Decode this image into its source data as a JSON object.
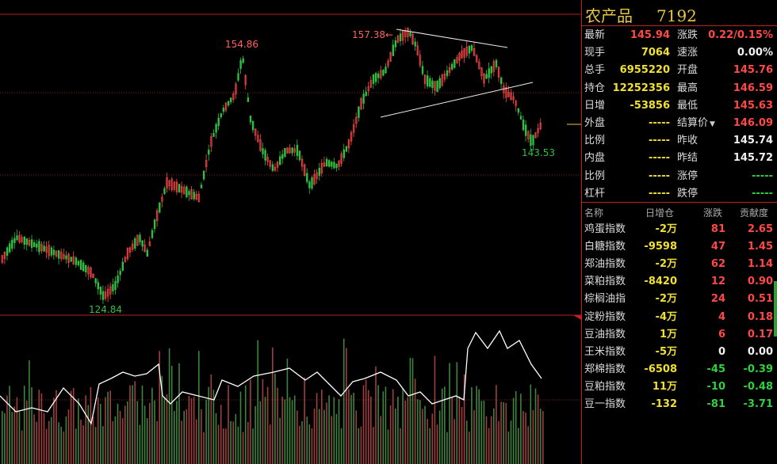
{
  "header": {
    "name": "农产品",
    "code": "7192"
  },
  "price_labels": {
    "high": "157.38",
    "high_arrow": "←",
    "mid_high": "154.86",
    "low": "124.84",
    "recent_low": "143.53"
  },
  "quote_left": [
    {
      "label": "最新",
      "value": "145.94",
      "color": "red"
    },
    {
      "label": "现手",
      "value": "7064",
      "color": "yel"
    },
    {
      "label": "总手",
      "value": "6955220",
      "color": "yel"
    },
    {
      "label": "持仓",
      "value": "12252356",
      "color": "yel"
    },
    {
      "label": "日增",
      "value": "-53856",
      "color": "yel"
    },
    {
      "label": "外盘",
      "value": "-----",
      "color": "yel"
    },
    {
      "label": "比例",
      "value": "-----",
      "color": "yel"
    },
    {
      "label": "内盘",
      "value": "-----",
      "color": "yel"
    },
    {
      "label": "比例",
      "value": "-----",
      "color": "yel"
    },
    {
      "label": "杠杆",
      "value": "-----",
      "color": "yel"
    }
  ],
  "quote_right": [
    {
      "label": "涨跌",
      "value": "0.22/0.15%",
      "color": "red"
    },
    {
      "label": "速涨",
      "value": "0.00%",
      "color": "wht"
    },
    {
      "label": "开盘",
      "value": "145.76",
      "color": "red"
    },
    {
      "label": "最高",
      "value": "146.59",
      "color": "red"
    },
    {
      "label": "最低",
      "value": "145.63",
      "color": "red"
    },
    {
      "label": "结算价",
      "value": "146.09",
      "color": "red",
      "dropdown": "▼"
    },
    {
      "label": "昨收",
      "value": "145.74",
      "color": "wht"
    },
    {
      "label": "昨结",
      "value": "145.72",
      "color": "wht"
    },
    {
      "label": "涨停",
      "value": "-----",
      "color": "grn"
    },
    {
      "label": "跌停",
      "value": "-----",
      "color": "grn"
    }
  ],
  "constituents": {
    "headers": [
      "名称",
      "日增仓",
      "涨跌",
      "贡献度"
    ],
    "rows": [
      {
        "name": "鸡蛋指数",
        "oi": "-2万",
        "chg": "81",
        "contrib": "2.65",
        "c": "red"
      },
      {
        "name": "白糖指数",
        "oi": "-9598",
        "chg": "47",
        "contrib": "1.45",
        "c": "red"
      },
      {
        "name": "郑油指数",
        "oi": "-2万",
        "chg": "62",
        "contrib": "1.14",
        "c": "red"
      },
      {
        "name": "菜粕指数",
        "oi": "-8420",
        "chg": "12",
        "contrib": "0.90",
        "c": "red"
      },
      {
        "name": "棕榈油指",
        "oi": "-2万",
        "chg": "24",
        "contrib": "0.51",
        "c": "red"
      },
      {
        "name": "淀粉指数",
        "oi": "-4万",
        "chg": "4",
        "contrib": "0.18",
        "c": "red"
      },
      {
        "name": "豆油指数",
        "oi": "1万",
        "chg": "6",
        "contrib": "0.17",
        "c": "red"
      },
      {
        "name": "王米指数",
        "oi": "-5万",
        "chg": "0",
        "contrib": "0.00",
        "c": "wht"
      },
      {
        "name": "郑棉指数",
        "oi": "-6508",
        "chg": "-45",
        "contrib": "-0.39",
        "c": "grn"
      },
      {
        "name": "豆粕指数",
        "oi": "11万",
        "chg": "-10",
        "contrib": "-0.48",
        "c": "grn"
      },
      {
        "name": "豆一指数",
        "oi": "-132",
        "chg": "-81",
        "contrib": "-3.71",
        "c": "grn"
      }
    ]
  },
  "colors": {
    "up": "#ff4848",
    "down": "#2ec040",
    "grid": "#b02020",
    "line": "#ffffff"
  }
}
